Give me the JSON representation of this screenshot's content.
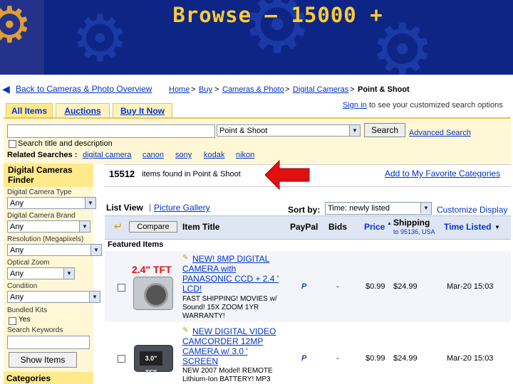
{
  "slide": {
    "title": "Browse – 15000 +"
  },
  "nav": {
    "back_link": "Back to Cameras & Photo Overview",
    "breadcrumb": [
      {
        "label": "Home"
      },
      {
        "label": "Buy"
      },
      {
        "label": "Cameras & Photo"
      },
      {
        "label": "Digital Cameras"
      },
      {
        "label": "Point & Shoot"
      }
    ],
    "crumb_sep": ">"
  },
  "tabs": [
    {
      "label": "All Items"
    },
    {
      "label": "Auctions"
    },
    {
      "label": "Buy It Now"
    }
  ],
  "signin": {
    "link": "Sign in",
    "text": "to see your customized search options"
  },
  "search": {
    "input_value": "",
    "category_value": "Point & Shoot",
    "button_label": "Search",
    "advanced_label": "Advanced Search",
    "title_desc_label": "Search title and description"
  },
  "related": {
    "label": "Related Searches :",
    "items": [
      "digital camera",
      "canon",
      "sony",
      "kodak",
      "nikon"
    ]
  },
  "finder": {
    "title_line1": "Digital Cameras",
    "title_line2": "Finder",
    "fields": [
      {
        "label": "Digital Camera Type",
        "value": "Any"
      },
      {
        "label": "Digital Camera Brand",
        "value": "Any"
      },
      {
        "label": "Resolution (Megapixels)",
        "value": "Any"
      },
      {
        "label": "Optical Zoom",
        "value": "Any"
      },
      {
        "label": "Condition",
        "value": "Any"
      }
    ],
    "bundled_label": "Bundled Kits",
    "yes_label": "Yes",
    "keyword_label": "Search Keywords",
    "show_button": "Show Items",
    "categories_label": "Categories"
  },
  "results": {
    "count": "15512",
    "found_text": "items found in Point & Shoot",
    "add_favorite": "Add to My Favorite Categories"
  },
  "view": {
    "list_view": "List View",
    "separator": "|",
    "picture_gallery": "Picture Gallery",
    "sort_label": "Sort by:",
    "sort_value": "Time: newly listed",
    "customize": "Customize Display"
  },
  "table": {
    "compare_button": "Compare",
    "item_title": "Item Title",
    "paypal": "PayPal",
    "bids": "Bids",
    "price": "Price",
    "shipping": "Shipping",
    "shipping_to": "to 95136, USA",
    "time_listed": "Time Listed",
    "featured": "Featured Items"
  },
  "items": [
    {
      "title_lines": [
        "NEW! 8MP DIGITAL",
        "CAMERA with",
        "PANASONIC CCD + 2.4 '",
        "LCD!"
      ],
      "subtitle_lines": [
        "FAST SHIPPING! MOVIES w/",
        "Sound! 15X ZOOM 1YR",
        "WARRANTY!"
      ],
      "thumb_label": "2.4\" TFT",
      "bids": "-",
      "price": "$0.99",
      "shipping": "$24.99",
      "time": "Mar-20 15:03"
    },
    {
      "title_lines": [
        "NEW DIGITAL VIDEO",
        "CAMCORDER 12MP",
        "CAMERA w/ 3.0 '",
        "SCREEN"
      ],
      "subtitle_lines": [
        "NEW 2007 Model! REMOTE",
        "Lithium-Ion BATTERY! MP3"
      ],
      "thumb_label": "3.0\" TFT",
      "bids": "-",
      "price": "$0.99",
      "shipping": "$24.99",
      "time": "Mar-20 15:03"
    }
  ],
  "icons": {
    "back": "back-arrow-icon",
    "paypal": "paypal-icon",
    "sort": "sort-arrow-icon",
    "compare": "compare-arrow-icon",
    "pointer": "red-arrow-icon"
  },
  "colors": {
    "slide_bg": "#0d2585",
    "title": "#ffcc33",
    "tab": "#ffe98a",
    "finder_bg": "#ffe98a",
    "link": "#0033cc",
    "pointer": "#e01010"
  }
}
